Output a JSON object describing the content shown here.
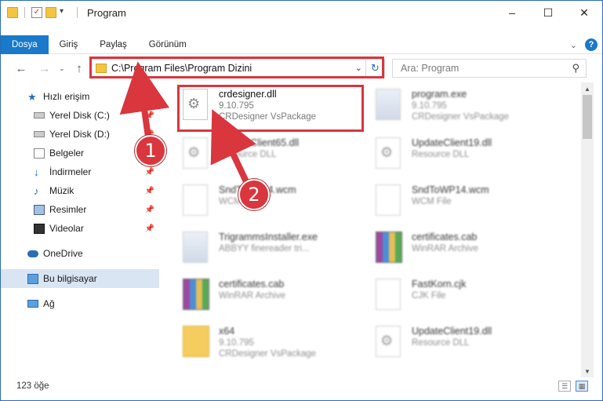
{
  "window": {
    "title": "Program",
    "controls": [
      "–",
      "☐",
      "✕"
    ]
  },
  "ribbon": {
    "tabs": [
      "Dosya",
      "Giriş",
      "Paylaş",
      "Görünüm"
    ]
  },
  "nav": {
    "address": "C:\\Program Files\\Program Dizini",
    "search_placeholder": "Ara: Program"
  },
  "sidebar": {
    "items": [
      {
        "label": "Hızlı erişim",
        "icon": "star-icon",
        "pinned": false
      },
      {
        "label": "Yerel Disk (C:)",
        "icon": "drive-icon",
        "pinned": true
      },
      {
        "label": "Yerel Disk (D:)",
        "icon": "drive-icon",
        "pinned": true
      },
      {
        "label": "Belgeler",
        "icon": "documents-icon",
        "pinned": true
      },
      {
        "label": "İndirmeler",
        "icon": "download-icon",
        "pinned": true
      },
      {
        "label": "Müzik",
        "icon": "music-icon",
        "pinned": true
      },
      {
        "label": "Resimler",
        "icon": "pictures-icon",
        "pinned": true
      },
      {
        "label": "Videolar",
        "icon": "video-icon",
        "pinned": true
      },
      {
        "label": "OneDrive",
        "icon": "cloud-icon",
        "pinned": false
      },
      {
        "label": "Bu bilgisayar",
        "icon": "computer-icon",
        "pinned": false
      },
      {
        "label": "Ağ",
        "icon": "network-icon",
        "pinned": false
      }
    ]
  },
  "files": [
    {
      "name": "crdesigner.dll",
      "line2": "9.10.795",
      "line3": "CRDesigner VsPackage",
      "icon": "dll-icon",
      "highlight": true
    },
    {
      "name": "program.exe",
      "line2": "9.10.795",
      "line3": "CRDesigner VsPackage",
      "icon": "exe-icon"
    },
    {
      "name": "UpdateClient65.dll",
      "line2": "Resource DLL",
      "line3": "",
      "icon": "dll-icon"
    },
    {
      "name": "UpdateClient19.dll",
      "line2": "Resource DLL",
      "line3": "",
      "icon": "dll-icon"
    },
    {
      "name": "SndToWP14.wcm",
      "line2": "WCM File",
      "line3": "",
      "icon": "file-icon"
    },
    {
      "name": "SndToWP14.wcm",
      "line2": "WCM File",
      "line3": "",
      "icon": "file-icon"
    },
    {
      "name": "TrigrammsInstaller.exe",
      "line2": "ABBYY finereader tri...",
      "line3": "",
      "icon": "exe-icon"
    },
    {
      "name": "certificates.cab",
      "line2": "WinRAR Archive",
      "line3": "",
      "icon": "rar-icon"
    },
    {
      "name": "certificates.cab",
      "line2": "WinRAR Archive",
      "line3": "",
      "icon": "rar-icon"
    },
    {
      "name": "FastKorn.cjk",
      "line2": "CJK File",
      "line3": "",
      "icon": "file-icon"
    },
    {
      "name": "x64",
      "line2": "9.10.795",
      "line3": "CRDesigner VsPackage",
      "icon": "zip-folder-icon"
    },
    {
      "name": "UpdateClient19.dll",
      "line2": "Resource DLL",
      "line3": "",
      "icon": "dll-icon"
    }
  ],
  "status": {
    "count": "123 öğe"
  },
  "annotations": {
    "step1": "1",
    "step2": "2",
    "color": "#d9363e"
  }
}
